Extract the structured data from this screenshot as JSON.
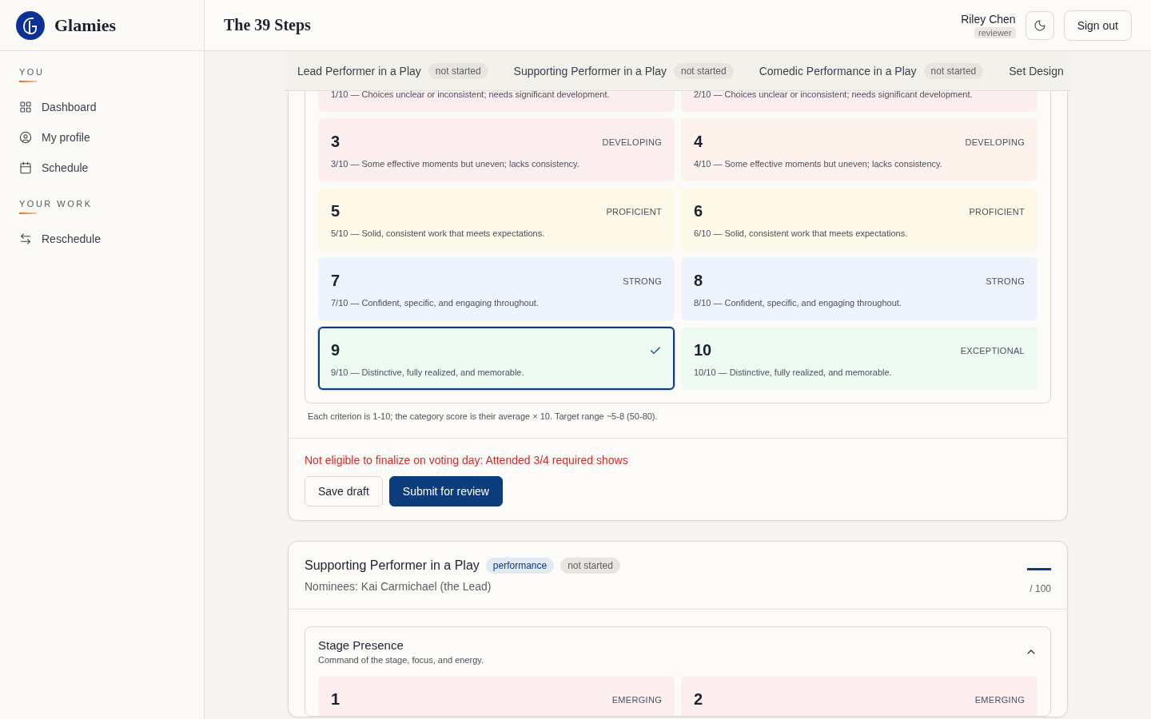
{
  "brand": {
    "name": "Glamies"
  },
  "page_title": "The 39 Steps",
  "user": {
    "name": "Riley Chen",
    "role": "reviewer"
  },
  "sign_out": "Sign out",
  "sidebar": {
    "sections": [
      {
        "heading": "YOU",
        "items": [
          {
            "label": "Dashboard",
            "kind": "grid"
          },
          {
            "label": "My profile",
            "kind": "user"
          },
          {
            "label": "Schedule",
            "kind": "calendar"
          }
        ]
      },
      {
        "heading": "YOUR WORK",
        "items": [
          {
            "label": "Reschedule",
            "kind": "swap"
          }
        ]
      }
    ]
  },
  "tabs": [
    {
      "label": "Lead Performer in a Play",
      "status": "not started"
    },
    {
      "label": "Supporting Performer in a Play",
      "status": "not started"
    },
    {
      "label": "Comedic Performance in a Play",
      "status": "not started"
    },
    {
      "label": "Set Design"
    }
  ],
  "current_category": {
    "options": [
      {
        "kind": "partial",
        "description": "1/10 — Choices unclear or inconsistent; needs significant development.",
        "color": "#fdeff0",
        "selected": false
      },
      {
        "kind": "partial",
        "description": "2/10 — Choices unclear or inconsistent; needs significant development.",
        "color": "#fdeff0",
        "selected": false
      },
      {
        "kind": "full",
        "score": "3",
        "level_label": "DEVELOPING",
        "description": "3/10 — Some effective moments but uneven; lacks consistency.",
        "color": "#fdeff0",
        "selected": false
      },
      {
        "kind": "full",
        "score": "4",
        "level_label": "DEVELOPING",
        "description": "4/10 — Some effective moments but uneven; lacks consistency.",
        "color": "#fdf3ec",
        "selected": false
      },
      {
        "kind": "full",
        "score": "5",
        "level_label": "PROFICIENT",
        "description": "5/10 — Solid, consistent work that meets expectations.",
        "color": "#fcf9e9",
        "selected": false
      },
      {
        "kind": "full",
        "score": "6",
        "level_label": "PROFICIENT",
        "description": "6/10 — Solid, consistent work that meets expectations.",
        "color": "#fcf9e9",
        "selected": false
      },
      {
        "kind": "full",
        "score": "7",
        "level_label": "STRONG",
        "description": "7/10 — Confident, specific, and engaging throughout.",
        "color": "#eef4fd",
        "selected": false
      },
      {
        "kind": "full",
        "score": "8",
        "level_label": "STRONG",
        "description": "8/10 — Confident, specific, and engaging throughout.",
        "color": "#eef4fd",
        "selected": false
      },
      {
        "kind": "full",
        "score": "9",
        "description": "9/10 — Distinctive, fully realized, and memorable.",
        "color": "#edfbf3",
        "selected": true
      },
      {
        "kind": "full",
        "score": "10",
        "level_label": "EXCEPTIONAL",
        "description": "10/10 — Distinctive, fully realized, and memorable.",
        "color": "#edfbf3",
        "selected": false
      }
    ],
    "note": "Each criterion is 1-10; the category score is their average × 10. Target range ~5-8 (50-80).",
    "error": "Not eligible to finalize on voting day: Attended 3/4 required shows",
    "buttons": [
      {
        "label": "Save draft",
        "kind": "secondary"
      },
      {
        "label": "Submit for review",
        "kind": "primary"
      }
    ]
  },
  "next_category": {
    "title": "Supporting Performer in a Play",
    "badges": [
      {
        "label": "performance",
        "kind": "type"
      },
      {
        "label": "not started",
        "kind": "status"
      }
    ],
    "nominees": "Nominees: Kai Carmichael (the Lead)",
    "score_max": "/ 100",
    "criterion": {
      "title": "Stage Presence",
      "description": "Command of the stage, focus, and energy.",
      "expanded": true,
      "options": [
        {
          "kind": "top",
          "score": "1",
          "level_label": "EMERGING",
          "color": "#fdeff0",
          "selected": false
        },
        {
          "kind": "top",
          "score": "2",
          "level_label": "EMERGING",
          "color": "#fdeff0",
          "selected": false
        }
      ]
    }
  }
}
